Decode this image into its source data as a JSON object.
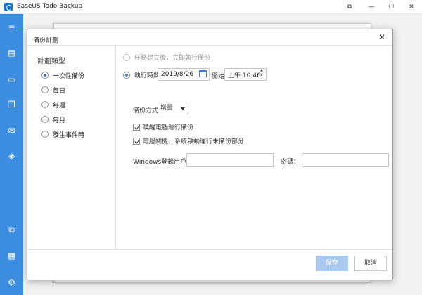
{
  "app": {
    "title": "EaseUS Todo Backup",
    "window_buttons": {
      "pin": "⧉",
      "minimize": "—",
      "maximize": "☐",
      "close": "✕"
    }
  },
  "sidebar": {
    "icons": [
      "menu-icon",
      "disk-backup-icon",
      "system-backup-icon",
      "file-backup-icon",
      "mail-backup-icon",
      "smart-backup-icon",
      "clone-icon",
      "tools-icon",
      "settings-icon"
    ]
  },
  "dialog": {
    "title": "備份計劃",
    "close": "✕",
    "plan_type": {
      "title": "計劃類型",
      "items": [
        {
          "label": "一次性備份",
          "selected": true
        },
        {
          "label": "每日",
          "selected": false
        },
        {
          "label": "每週",
          "selected": false
        },
        {
          "label": "每月",
          "selected": false
        },
        {
          "label": "發生事件時",
          "selected": false
        }
      ]
    },
    "run_after_create": {
      "label": "任務建立後，立即執行備份",
      "enabled": false
    },
    "run_at": {
      "label": "執行時間",
      "date": "2019/8/26",
      "start_label": "開始",
      "time": "上午 10:46"
    },
    "backup_method": {
      "label": "備份方式",
      "value": "增量"
    },
    "wake_pc": {
      "label": "喚醒電腦運行備份",
      "checked": true
    },
    "shutdown_run": {
      "label": "電腦關機，系統啟動運行未備份部分",
      "checked": true
    },
    "windows_user": {
      "label": "Windows登錄用戶：",
      "value": ""
    },
    "password": {
      "label": "密碼：",
      "value": ""
    },
    "buttons": {
      "save": "保存",
      "cancel": "取消"
    }
  },
  "colors": {
    "sidebar": "#3c8ee0",
    "accent": "#3a7bd5",
    "save_button": "#a9c9ee"
  }
}
